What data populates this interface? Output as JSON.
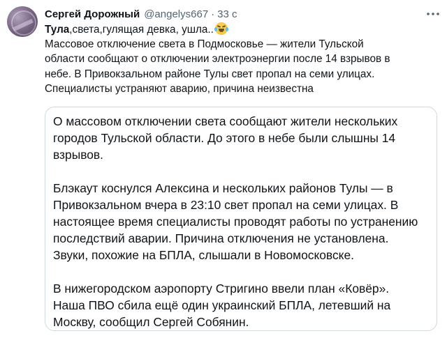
{
  "author": {
    "name": "Сергей Дорожный",
    "handle": "@angelys667",
    "separator": "·",
    "time": "33 с"
  },
  "icons": {
    "avatar": "user-avatar",
    "more": "more-dots-icon",
    "emoji": "face-with-tears-of-joy-emoji"
  },
  "tweet": {
    "bold_word": "Тула",
    "line1_rest": ",света,гулящая девка, ушла..",
    "lines": [
      "Массовое отключение света в Подмосковье — жители Тульской",
      "области сообщают о отключении электроэнергии после 14 взрывов в",
      "небе. В Привокзальном районе Тулы свет пропал на семи улицах.",
      "Специалисты устраняют аварию, причина неизвестна"
    ]
  },
  "quote": {
    "paragraphs": [
      [
        "О массовом отключении света сообщают жители нескольких",
        "городов Тульской области. До этого в небе были слышны 14",
        "взрывов."
      ],
      [
        "Блэкаут коснулся Алексина и нескольких районов Тулы — в",
        "Привокзальном вчера в 23:10 свет пропал на семи улицах. В",
        "настоящее время специалисты проводят работы по устранению",
        "последствий аварии. Причина отключения не установлена.",
        "Звуки, похожие на БПЛА, слышали в Новомосковске."
      ],
      [
        "В нижегородском аэропорту Стригино ввели план «Ковёр».",
        "Наша ПВО сбила ещё один украинский БПЛА, летевший на",
        "Москву, сообщил Сергей Собянин."
      ]
    ]
  },
  "colors": {
    "text": "#0f1419",
    "secondary": "#536471",
    "border": "#cfd9de"
  }
}
